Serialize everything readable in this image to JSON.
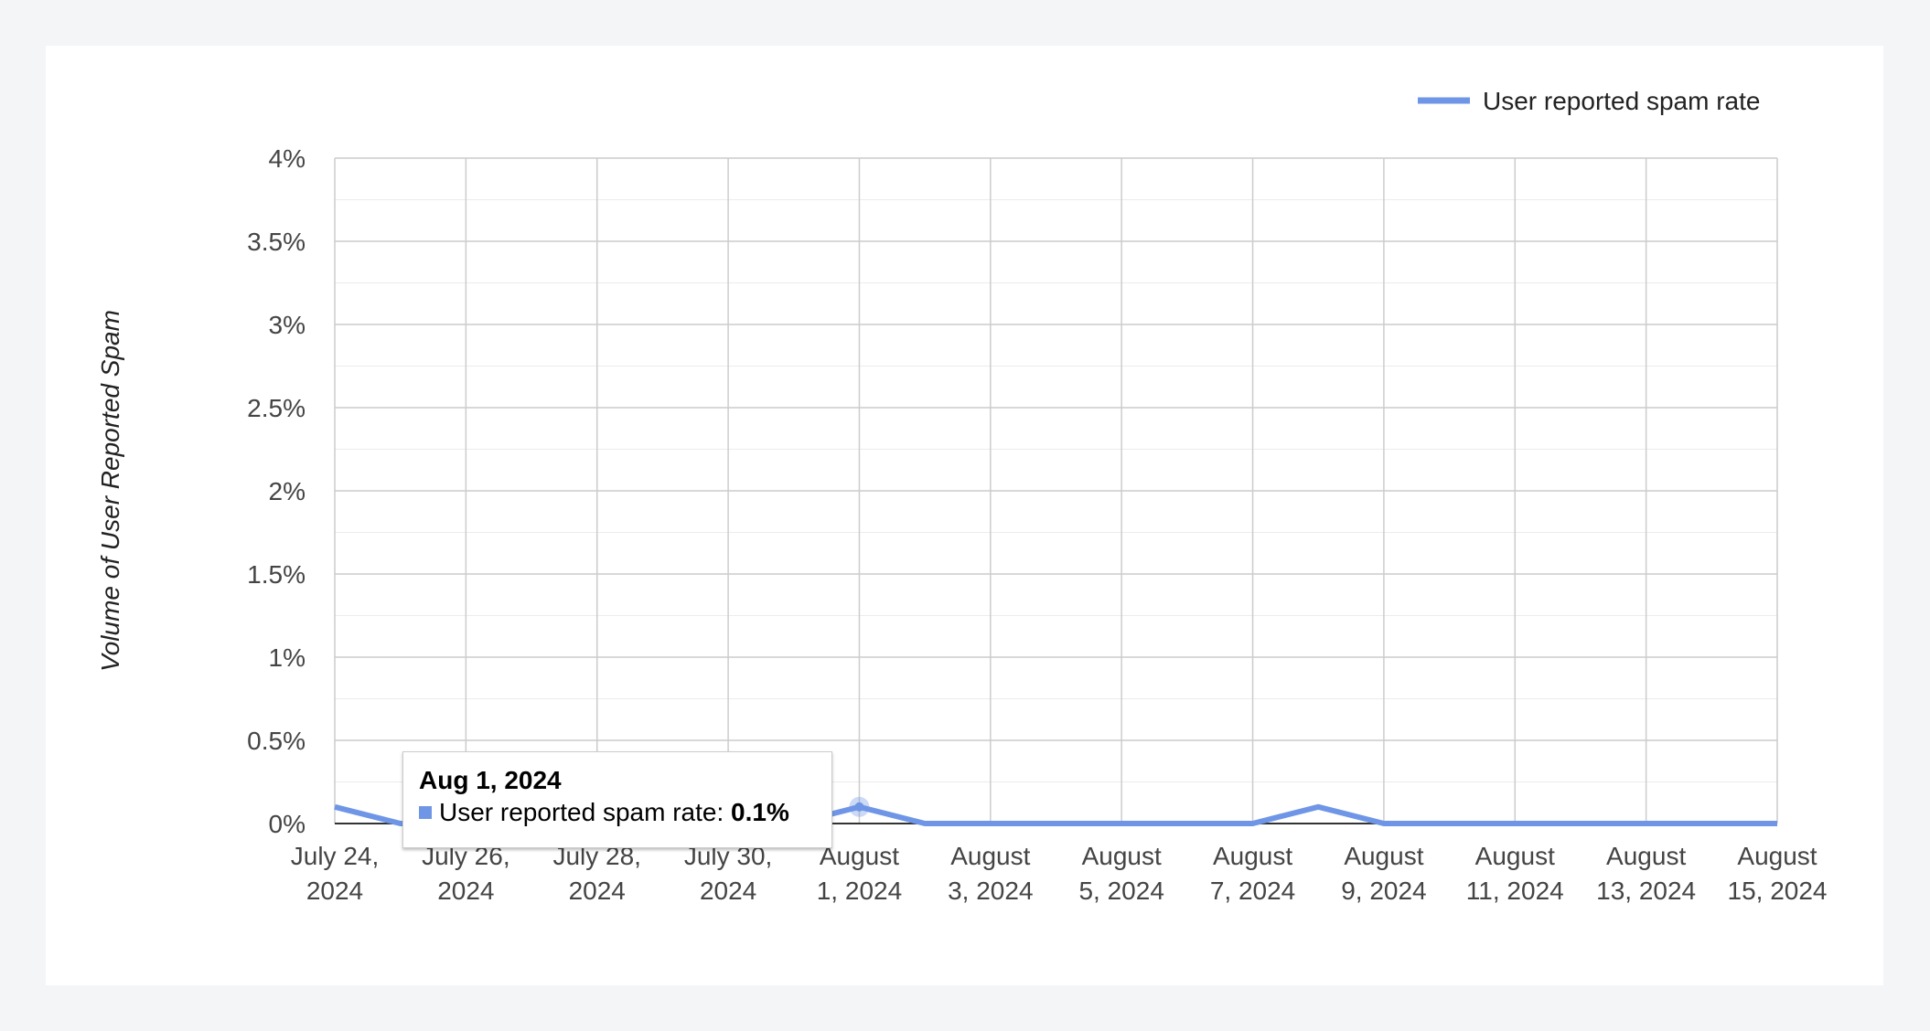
{
  "chart_data": {
    "type": "line",
    "ylabel": "Volume of User Reported Spam",
    "xlabel": "",
    "ylim": [
      0,
      4
    ],
    "y_unit": "%",
    "y_ticks": [
      "0%",
      "0.5%",
      "1%",
      "1.5%",
      "2%",
      "2.5%",
      "3%",
      "3.5%",
      "4%"
    ],
    "x_range": [
      "2024-07-24",
      "2024-08-15"
    ],
    "x_ticks": [
      {
        "date": "2024-07-24",
        "line1": "July 24,",
        "line2": "2024"
      },
      {
        "date": "2024-07-26",
        "line1": "July 26,",
        "line2": "2024"
      },
      {
        "date": "2024-07-28",
        "line1": "July 28,",
        "line2": "2024"
      },
      {
        "date": "2024-07-30",
        "line1": "July 30,",
        "line2": "2024"
      },
      {
        "date": "2024-08-01",
        "line1": "August",
        "line2": "1, 2024"
      },
      {
        "date": "2024-08-03",
        "line1": "August",
        "line2": "3, 2024"
      },
      {
        "date": "2024-08-05",
        "line1": "August",
        "line2": "5, 2024"
      },
      {
        "date": "2024-08-07",
        "line1": "August",
        "line2": "7, 2024"
      },
      {
        "date": "2024-08-09",
        "line1": "August",
        "line2": "9, 2024"
      },
      {
        "date": "2024-08-11",
        "line1": "August",
        "line2": "11, 2024"
      },
      {
        "date": "2024-08-13",
        "line1": "August",
        "line2": "13, 2024"
      },
      {
        "date": "2024-08-15",
        "line1": "August",
        "line2": "15, 2024"
      }
    ],
    "grid": true,
    "legend": "top-right",
    "series": [
      {
        "name": "User reported spam rate",
        "color": "#6f96e6",
        "points": [
          {
            "x": "2024-07-24",
            "y": 0.1
          },
          {
            "x": "2024-07-25",
            "y": 0.0
          },
          {
            "x": "2024-07-26",
            "y": 0.0
          },
          {
            "x": "2024-07-27",
            "y": 0.0
          },
          {
            "x": "2024-07-28",
            "y": 0.0
          },
          {
            "x": "2024-07-29",
            "y": 0.0
          },
          {
            "x": "2024-07-30",
            "y": 0.0
          },
          {
            "x": "2024-07-31",
            "y": 0.0
          },
          {
            "x": "2024-08-01",
            "y": 0.1
          },
          {
            "x": "2024-08-02",
            "y": 0.0
          },
          {
            "x": "2024-08-03",
            "y": 0.0
          },
          {
            "x": "2024-08-04",
            "y": 0.0
          },
          {
            "x": "2024-08-05",
            "y": 0.0
          },
          {
            "x": "2024-08-06",
            "y": 0.0
          },
          {
            "x": "2024-08-07",
            "y": 0.0
          },
          {
            "x": "2024-08-08",
            "y": 0.1
          },
          {
            "x": "2024-08-09",
            "y": 0.0
          },
          {
            "x": "2024-08-10",
            "y": 0.0
          },
          {
            "x": "2024-08-11",
            "y": 0.0
          },
          {
            "x": "2024-08-12",
            "y": 0.0
          },
          {
            "x": "2024-08-13",
            "y": 0.0
          },
          {
            "x": "2024-08-14",
            "y": 0.0
          },
          {
            "x": "2024-08-15",
            "y": 0.0
          }
        ]
      }
    ],
    "tooltip": {
      "x": "2024-08-01",
      "title": "Aug 1, 2024",
      "label": "User reported spam rate: ",
      "value": "0.1%"
    }
  }
}
